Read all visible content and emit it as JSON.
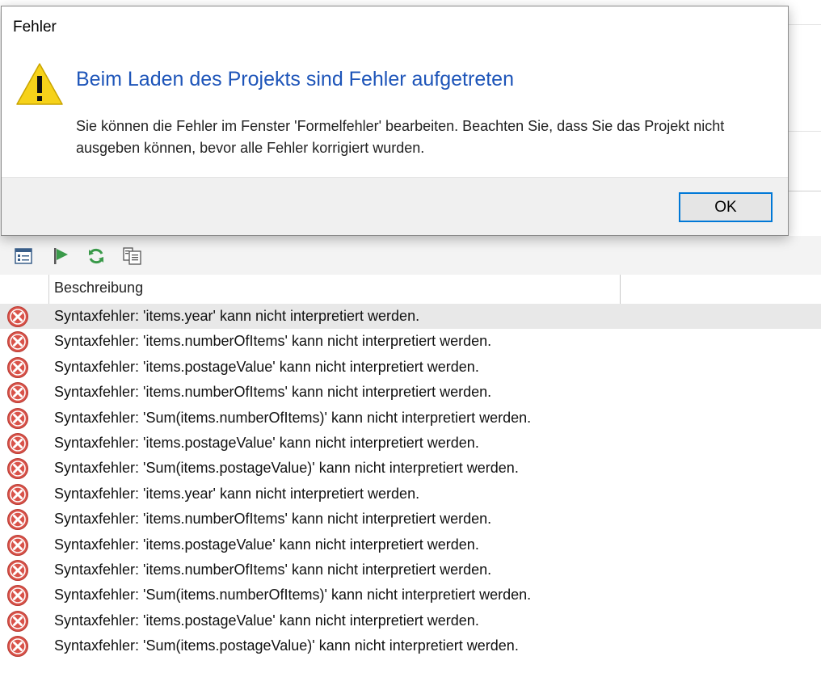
{
  "dialog": {
    "title": "Fehler",
    "heading": "Beim Laden des Projekts sind Fehler aufgetreten",
    "message": "Sie können die Fehler im Fenster 'Formelfehler' bearbeiten. Beachten Sie, dass Sie das Projekt nicht ausgeben können, bevor alle Fehler korrigiert wurden.",
    "ok_label": "OK",
    "icon": "warning-icon"
  },
  "toolbar": {
    "buttons": [
      "details-view-icon",
      "run-flag-icon",
      "refresh-icon",
      "copy-list-icon"
    ]
  },
  "list": {
    "column_description": "Beschreibung",
    "rows": [
      "Syntaxfehler: 'items.year' kann nicht interpretiert werden.",
      "Syntaxfehler: 'items.numberOfItems' kann nicht interpretiert werden.",
      "Syntaxfehler: 'items.postageValue' kann nicht interpretiert werden.",
      "Syntaxfehler: 'items.numberOfItems' kann nicht interpretiert werden.",
      "Syntaxfehler: 'Sum(items.numberOfItems)' kann nicht interpretiert werden.",
      "Syntaxfehler: 'items.postageValue' kann nicht interpretiert werden.",
      "Syntaxfehler: 'Sum(items.postageValue)' kann nicht interpretiert werden.",
      "Syntaxfehler: 'items.year' kann nicht interpretiert werden.",
      "Syntaxfehler: 'items.numberOfItems' kann nicht interpretiert werden.",
      "Syntaxfehler: 'items.postageValue' kann nicht interpretiert werden.",
      "Syntaxfehler: 'items.numberOfItems' kann nicht interpretiert werden.",
      "Syntaxfehler: 'Sum(items.numberOfItems)' kann nicht interpretiert werden.",
      "Syntaxfehler: 'items.postageValue' kann nicht interpretiert werden.",
      "Syntaxfehler: 'Sum(items.postageValue)' kann nicht interpretiert werden."
    ],
    "row_icon": "error-icon"
  },
  "colors": {
    "heading": "#1e55b9",
    "error_red": "#d9534a",
    "warning_yellow": "#f6d21a",
    "accent": "#0078d7"
  }
}
